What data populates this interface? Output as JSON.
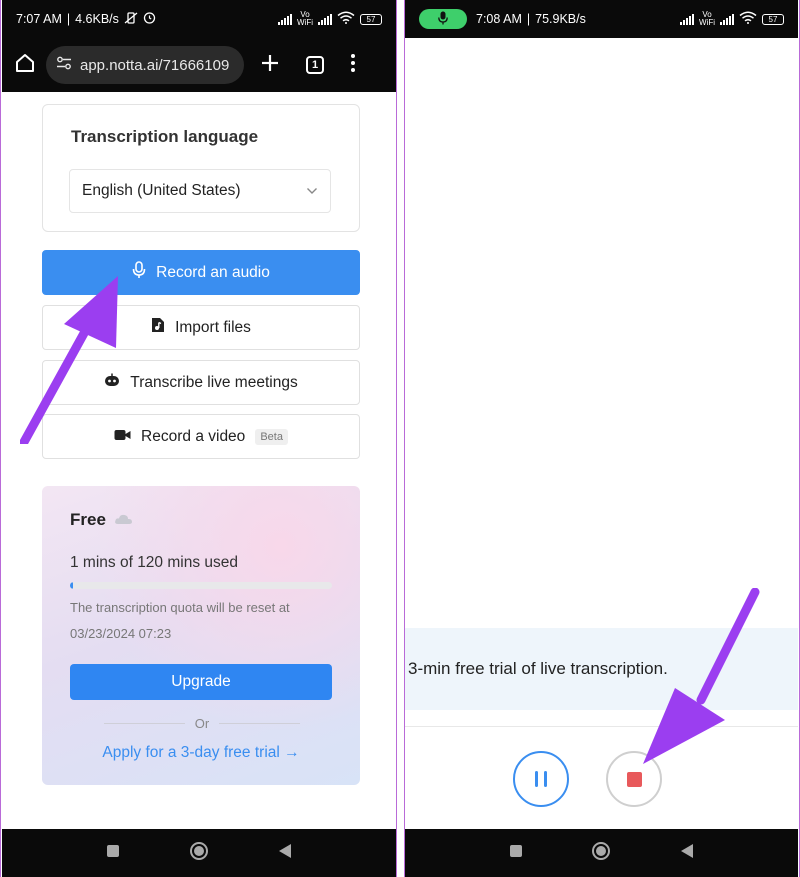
{
  "left_screen": {
    "status": {
      "time": "7:07 AM",
      "speed": "4.6KB/s",
      "net_top": "Vo",
      "net_bottom": "WiFi",
      "battery": "57"
    },
    "browser": {
      "url": "app.notta.ai/71666109",
      "tab_count": "1"
    },
    "language": {
      "title": "Transcription language",
      "selected": "English (United States)"
    },
    "actions": {
      "record_audio": "Record an audio",
      "import_files": "Import files",
      "live_meetings": "Transcribe live meetings",
      "record_video": "Record a video",
      "beta_badge": "Beta"
    },
    "plan": {
      "name": "Free",
      "usage": "1 mins of 120 mins used",
      "progress_fraction": 0.008,
      "reset_note": "The transcription quota will be reset at",
      "reset_date": "03/23/2024 07:23",
      "upgrade_label": "Upgrade",
      "or_label": "Or",
      "trial_link": "Apply for a 3-day free trial →"
    }
  },
  "right_screen": {
    "status": {
      "time": "7:08 AM",
      "speed": "75.9KB/s",
      "net_top": "Vo",
      "net_bottom": "WiFi",
      "battery": "57"
    },
    "banner_text": "3-min free trial of live transcription."
  },
  "colors": {
    "accent": "#3a8ef0",
    "stop": "#e8595b",
    "annotation_arrow": "#9b3ef0",
    "recording_pill": "#3ecf6b"
  }
}
